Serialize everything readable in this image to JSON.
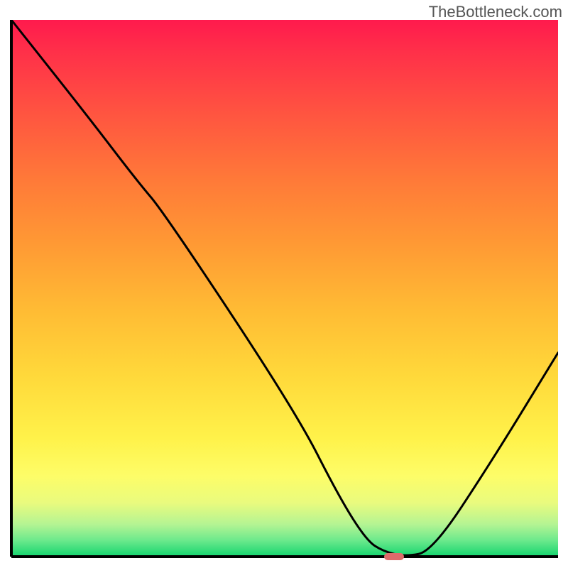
{
  "watermark": "TheBottleneck.com",
  "chart_data": {
    "type": "line",
    "title": "",
    "xlabel": "",
    "ylabel": "",
    "xlim": [
      0,
      100
    ],
    "ylim": [
      0,
      100
    ],
    "series": [
      {
        "name": "bottleneck-curve",
        "x": [
          0,
          14,
          23,
          28,
          52,
          60,
          65,
          68,
          72,
          77,
          88,
          100
        ],
        "values": [
          100,
          82,
          70,
          64,
          27,
          11,
          3,
          1,
          0,
          1,
          18,
          38
        ]
      }
    ],
    "annotations": [
      {
        "name": "optimal-marker",
        "x": 70,
        "y": 0,
        "color": "#de6b6b"
      }
    ],
    "background_gradient_stops": [
      {
        "pos": 0,
        "color": "#ff1a4d"
      },
      {
        "pos": 50,
        "color": "#ffbb34"
      },
      {
        "pos": 85,
        "color": "#fdfd68"
      },
      {
        "pos": 100,
        "color": "#13d46e"
      }
    ]
  }
}
